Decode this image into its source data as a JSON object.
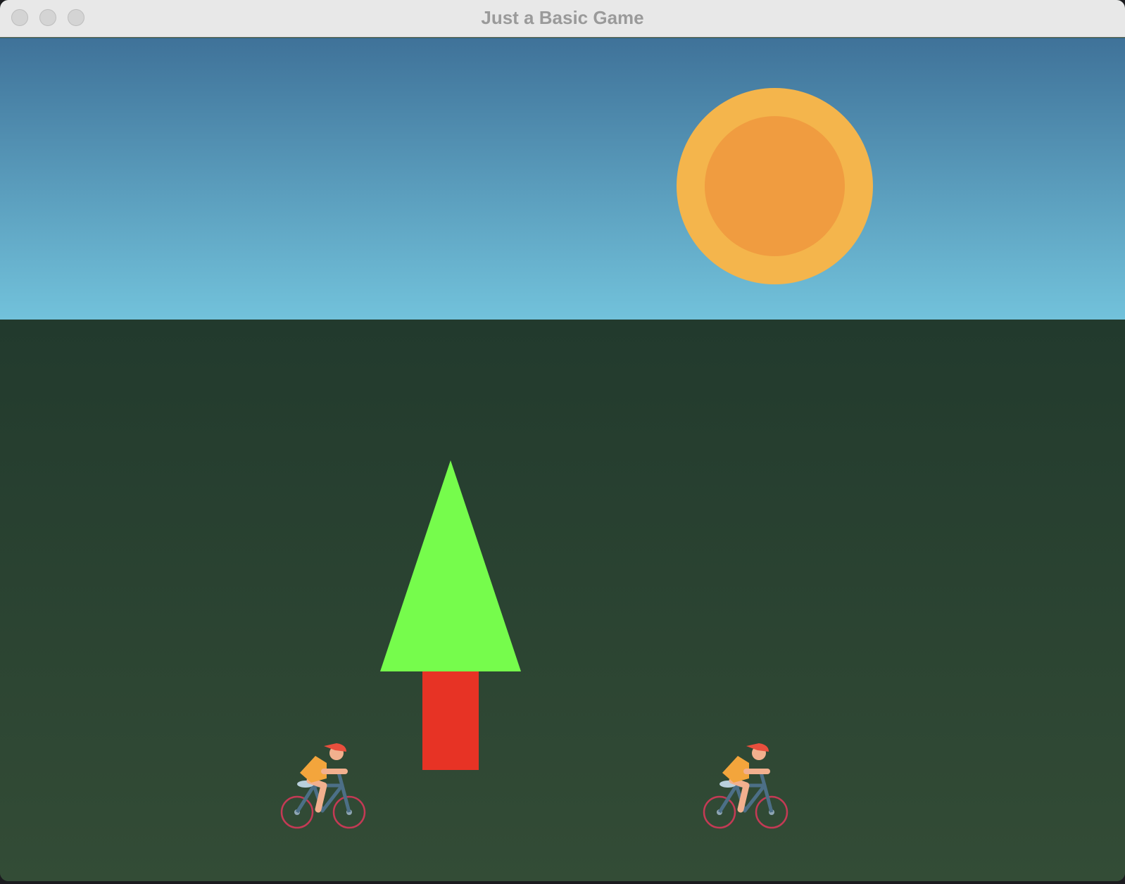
{
  "window": {
    "title": "Just a Basic Game"
  },
  "titlebar": {
    "buttons": [
      "close",
      "minimize",
      "zoom"
    ]
  },
  "scene": {
    "sky": {
      "top_color": "#3f7299",
      "bottom_color": "#72c2db"
    },
    "ground": {
      "top_color": "#223a2d",
      "bottom_color": "#334c36"
    },
    "sun": {
      "outer_color": "#f4b54c",
      "inner_color": "#f09c40"
    },
    "tree": {
      "foliage_color": "#76fc4c",
      "trunk_color": "#e73325"
    },
    "cyclists": [
      {
        "icon": "cyclist-icon"
      },
      {
        "icon": "cyclist-icon"
      }
    ]
  }
}
